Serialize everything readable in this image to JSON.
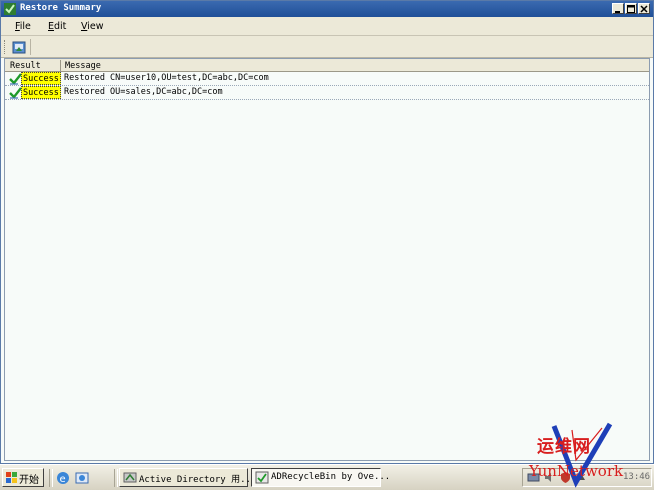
{
  "window": {
    "title": "Restore Summary",
    "controls": [
      "minimize",
      "maximize",
      "close"
    ]
  },
  "menu": {
    "items": [
      {
        "label_first": "F",
        "label_rest": "ile"
      },
      {
        "label_first": "E",
        "label_rest": "dit"
      },
      {
        "label_first": "V",
        "label_rest": "iew"
      }
    ]
  },
  "toolbar": {
    "buttons": [
      {
        "icon": "export-icon"
      }
    ]
  },
  "table": {
    "columns": [
      "Result",
      "Message"
    ],
    "rows": [
      {
        "icon": "green-check-icon",
        "status": "Success",
        "message": "Restored CN=user10,OU=test,DC=abc,DC=com"
      },
      {
        "icon": "green-check-icon",
        "status": "Success",
        "message": "Restored OU=sales,DC=abc,DC=com"
      }
    ]
  },
  "taskbar": {
    "start_label": "开始",
    "quick_launch": [
      "ie-icon",
      "show-desktop-icon"
    ],
    "tasks": [
      {
        "label": "Active Directory 用...",
        "icon": "ad-icon",
        "active": false
      },
      {
        "label": "ADRecycleBin by Ove...",
        "icon": "app-icon",
        "active": true
      }
    ],
    "clock": "13:46"
  },
  "watermark": {
    "cn": "运维网",
    "en": "YunNetwork"
  },
  "colors": {
    "status_highlight": "#ffff00",
    "title_bar": "#2a5ca8",
    "watermark": "#d81e1e"
  }
}
